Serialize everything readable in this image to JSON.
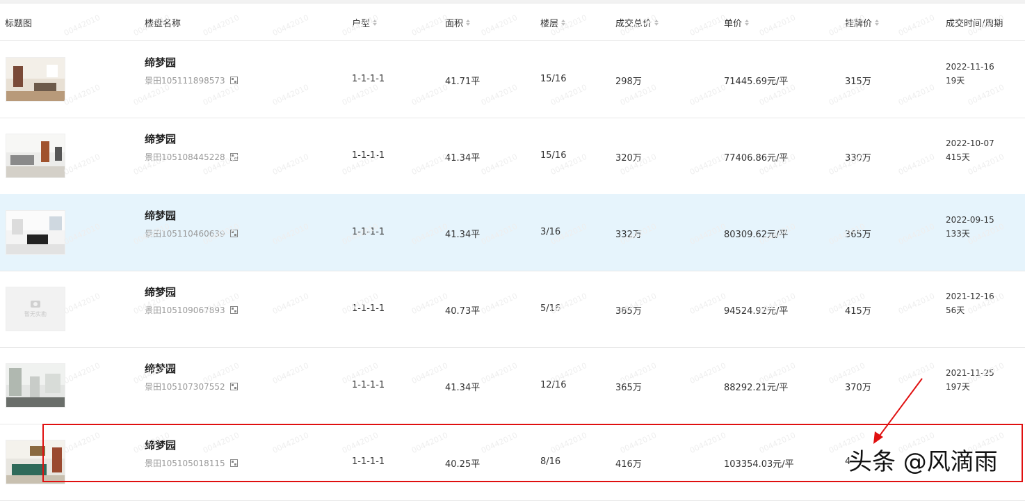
{
  "columns": {
    "thumb": "标题图",
    "name": "楼盘名称",
    "layout": "户型",
    "area": "面积",
    "floor": "楼层",
    "total": "成交总价",
    "unit": "单价",
    "list": "挂牌价",
    "time": "成交时间/周期"
  },
  "rows": [
    {
      "name": "缔梦园",
      "code": "景田105111898573",
      "layout": "1-1-1-1",
      "area": "41.71平",
      "floor": "15/16",
      "total": "298万",
      "unit": "71445.69元/平",
      "list": "315万",
      "date": "2022-11-16",
      "period": "19天"
    },
    {
      "name": "缔梦园",
      "code": "景田105108445228",
      "layout": "1-1-1-1",
      "area": "41.34平",
      "floor": "15/16",
      "total": "320万",
      "unit": "77406.86元/平",
      "list": "330万",
      "date": "2022-10-07",
      "period": "415天"
    },
    {
      "name": "缔梦园",
      "code": "景田105110460639",
      "layout": "1-1-1-1",
      "area": "41.34平",
      "floor": "3/16",
      "total": "332万",
      "unit": "80309.62元/平",
      "list": "365万",
      "date": "2022-09-15",
      "period": "133天"
    },
    {
      "name": "缔梦园",
      "code": "景田105109067893",
      "layout": "1-1-1-1",
      "area": "40.73平",
      "floor": "5/16",
      "total": "385万",
      "unit": "94524.92元/平",
      "list": "415万",
      "date": "2021-12-16",
      "period": "56天",
      "no_image": "暂无实勘"
    },
    {
      "name": "缔梦园",
      "code": "景田105107307552",
      "layout": "1-1-1-1",
      "area": "41.34平",
      "floor": "12/16",
      "total": "365万",
      "unit": "88292.21元/平",
      "list": "370万",
      "date": "2021-11-25",
      "period": "197天"
    },
    {
      "name": "缔梦园",
      "code": "景田105105018115",
      "layout": "1-1-1-1",
      "area": "40.25平",
      "floor": "8/16",
      "total": "416万",
      "unit": "103354.03元/平",
      "list": "4",
      "date": "",
      "period": ""
    }
  ],
  "watermark": "00442010",
  "overlay_brand": "头条 @风滴雨",
  "colors": {
    "highlight": "#e6f4fc",
    "annotation": "#e01010"
  }
}
